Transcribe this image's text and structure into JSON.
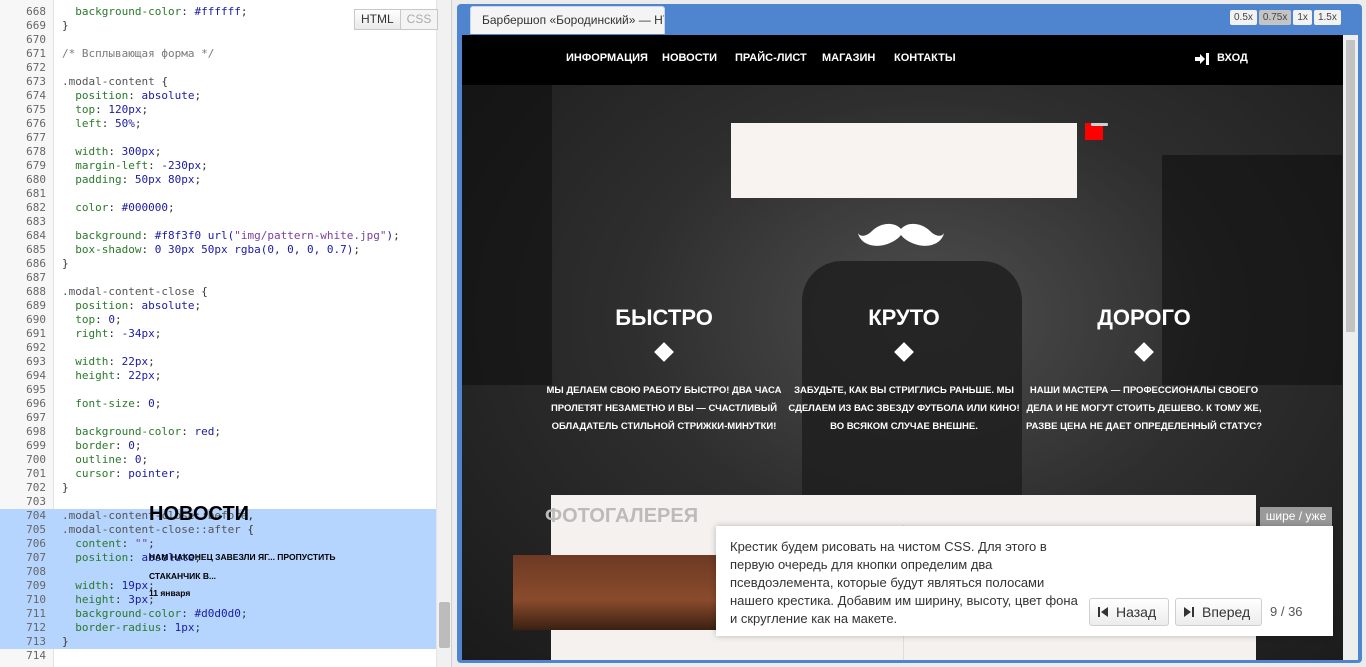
{
  "editor": {
    "tabs": [
      "HTML",
      "CSS"
    ],
    "lines": [
      {
        "n": "668",
        "tokens": [
          [
            "prop",
            "  background-color"
          ],
          [
            "pun",
            ": "
          ],
          [
            "val",
            "#ffffff"
          ],
          [
            "pun",
            ";"
          ]
        ]
      },
      {
        "n": "669",
        "tokens": [
          [
            "pun",
            "}"
          ]
        ]
      },
      {
        "n": "670",
        "tokens": []
      },
      {
        "n": "671",
        "tokens": [
          [
            "com",
            "/* Всплывающая форма */"
          ]
        ]
      },
      {
        "n": "672",
        "tokens": []
      },
      {
        "n": "673",
        "tokens": [
          [
            "sel",
            ".modal-content"
          ],
          [
            "pun",
            " {"
          ]
        ]
      },
      {
        "n": "674",
        "tokens": [
          [
            "prop",
            "  position"
          ],
          [
            "pun",
            ": "
          ],
          [
            "val",
            "absolute"
          ],
          [
            "pun",
            ";"
          ]
        ]
      },
      {
        "n": "675",
        "tokens": [
          [
            "prop",
            "  top"
          ],
          [
            "pun",
            ": "
          ],
          [
            "val",
            "120px"
          ],
          [
            "pun",
            ";"
          ]
        ]
      },
      {
        "n": "676",
        "tokens": [
          [
            "prop",
            "  left"
          ],
          [
            "pun",
            ": "
          ],
          [
            "val",
            "50%"
          ],
          [
            "pun",
            ";"
          ]
        ]
      },
      {
        "n": "677",
        "tokens": []
      },
      {
        "n": "678",
        "tokens": [
          [
            "prop",
            "  width"
          ],
          [
            "pun",
            ": "
          ],
          [
            "val",
            "300px"
          ],
          [
            "pun",
            ";"
          ]
        ]
      },
      {
        "n": "679",
        "tokens": [
          [
            "prop",
            "  margin-left"
          ],
          [
            "pun",
            ": "
          ],
          [
            "val",
            "-230px"
          ],
          [
            "pun",
            ";"
          ]
        ]
      },
      {
        "n": "680",
        "tokens": [
          [
            "prop",
            "  padding"
          ],
          [
            "pun",
            ": "
          ],
          [
            "val",
            "50px 80px"
          ],
          [
            "pun",
            ";"
          ]
        ]
      },
      {
        "n": "681",
        "tokens": []
      },
      {
        "n": "682",
        "tokens": [
          [
            "prop",
            "  color"
          ],
          [
            "pun",
            ": "
          ],
          [
            "val",
            "#000000"
          ],
          [
            "pun",
            ";"
          ]
        ]
      },
      {
        "n": "683",
        "tokens": []
      },
      {
        "n": "684",
        "tokens": [
          [
            "prop",
            "  background"
          ],
          [
            "pun",
            ": "
          ],
          [
            "val",
            "#f8f3f0 url("
          ],
          [
            "str",
            "\"img/pattern-white.jpg\""
          ],
          [
            "val",
            ")"
          ],
          [
            "pun",
            ";"
          ]
        ]
      },
      {
        "n": "685",
        "tokens": [
          [
            "prop",
            "  box-shadow"
          ],
          [
            "pun",
            ": "
          ],
          [
            "val",
            "0 30px 50px rgba(0, 0, 0, 0.7)"
          ],
          [
            "pun",
            ";"
          ]
        ]
      },
      {
        "n": "686",
        "tokens": [
          [
            "pun",
            "}"
          ]
        ]
      },
      {
        "n": "687",
        "tokens": []
      },
      {
        "n": "688",
        "tokens": [
          [
            "sel",
            ".modal-content-close"
          ],
          [
            "pun",
            " {"
          ]
        ]
      },
      {
        "n": "689",
        "tokens": [
          [
            "prop",
            "  position"
          ],
          [
            "pun",
            ": "
          ],
          [
            "val",
            "absolute"
          ],
          [
            "pun",
            ";"
          ]
        ]
      },
      {
        "n": "690",
        "tokens": [
          [
            "prop",
            "  top"
          ],
          [
            "pun",
            ": "
          ],
          [
            "val",
            "0"
          ],
          [
            "pun",
            ";"
          ]
        ]
      },
      {
        "n": "691",
        "tokens": [
          [
            "prop",
            "  right"
          ],
          [
            "pun",
            ": "
          ],
          [
            "val",
            "-34px"
          ],
          [
            "pun",
            ";"
          ]
        ]
      },
      {
        "n": "692",
        "tokens": []
      },
      {
        "n": "693",
        "tokens": [
          [
            "prop",
            "  width"
          ],
          [
            "pun",
            ": "
          ],
          [
            "val",
            "22px"
          ],
          [
            "pun",
            ";"
          ]
        ]
      },
      {
        "n": "694",
        "tokens": [
          [
            "prop",
            "  height"
          ],
          [
            "pun",
            ": "
          ],
          [
            "val",
            "22px"
          ],
          [
            "pun",
            ";"
          ]
        ]
      },
      {
        "n": "695",
        "tokens": []
      },
      {
        "n": "696",
        "tokens": [
          [
            "prop",
            "  font-size"
          ],
          [
            "pun",
            ": "
          ],
          [
            "val",
            "0"
          ],
          [
            "pun",
            ";"
          ]
        ]
      },
      {
        "n": "697",
        "tokens": []
      },
      {
        "n": "698",
        "tokens": [
          [
            "prop",
            "  background-color"
          ],
          [
            "pun",
            ": "
          ],
          [
            "val",
            "red"
          ],
          [
            "pun",
            ";"
          ]
        ]
      },
      {
        "n": "699",
        "tokens": [
          [
            "prop",
            "  border"
          ],
          [
            "pun",
            ": "
          ],
          [
            "val",
            "0"
          ],
          [
            "pun",
            ";"
          ]
        ]
      },
      {
        "n": "700",
        "tokens": [
          [
            "prop",
            "  outline"
          ],
          [
            "pun",
            ": "
          ],
          [
            "val",
            "0"
          ],
          [
            "pun",
            ";"
          ]
        ]
      },
      {
        "n": "701",
        "tokens": [
          [
            "prop",
            "  cursor"
          ],
          [
            "pun",
            ": "
          ],
          [
            "val",
            "pointer"
          ],
          [
            "pun",
            ";"
          ]
        ]
      },
      {
        "n": "702",
        "tokens": [
          [
            "pun",
            "}"
          ]
        ]
      },
      {
        "n": "703",
        "tokens": []
      },
      {
        "n": "704",
        "hl": true,
        "tokens": [
          [
            "sel",
            ".modal-content-close::before"
          ],
          [
            "pun",
            ","
          ]
        ]
      },
      {
        "n": "705",
        "hl": true,
        "tokens": [
          [
            "sel",
            ".modal-content-close::after"
          ],
          [
            "pun",
            " {"
          ]
        ]
      },
      {
        "n": "706",
        "hl": true,
        "tokens": [
          [
            "prop",
            "  content"
          ],
          [
            "pun",
            ": "
          ],
          [
            "str",
            "\"\""
          ],
          [
            "pun",
            ";"
          ]
        ]
      },
      {
        "n": "707",
        "hl": true,
        "tokens": [
          [
            "prop",
            "  position"
          ],
          [
            "pun",
            ": "
          ],
          [
            "val",
            "absolute"
          ],
          [
            "pun",
            ";"
          ]
        ]
      },
      {
        "n": "708",
        "hl": true,
        "tokens": []
      },
      {
        "n": "709",
        "hl": true,
        "tokens": [
          [
            "prop",
            "  width"
          ],
          [
            "pun",
            ": "
          ],
          [
            "val",
            "19px"
          ],
          [
            "pun",
            ";"
          ]
        ]
      },
      {
        "n": "710",
        "hl": true,
        "tokens": [
          [
            "prop",
            "  height"
          ],
          [
            "pun",
            ": "
          ],
          [
            "val",
            "3px"
          ],
          [
            "pun",
            ";"
          ]
        ]
      },
      {
        "n": "711",
        "hl": true,
        "tokens": [
          [
            "prop",
            "  background-color"
          ],
          [
            "pun",
            ": "
          ],
          [
            "val",
            "#d0d0d0"
          ],
          [
            "pun",
            ";"
          ]
        ]
      },
      {
        "n": "712",
        "hl": true,
        "tokens": [
          [
            "prop",
            "  border-radius"
          ],
          [
            "pun",
            ": "
          ],
          [
            "val",
            "1px"
          ],
          [
            "pun",
            ";"
          ]
        ]
      },
      {
        "n": "713",
        "hl": true,
        "tokens": [
          [
            "pun",
            "}"
          ]
        ]
      },
      {
        "n": "714",
        "tokens": []
      }
    ]
  },
  "browser": {
    "tab_title": "Барбершоп «Бородинский» — HTML",
    "zoom_options": [
      "0.5x",
      "0.75x",
      "1x",
      "1.5x"
    ],
    "zoom_active": "0.75x"
  },
  "site": {
    "nav": [
      "ИНФОРМАЦИЯ",
      "НОВОСТИ",
      "ПРАЙС-ЛИСТ",
      "МАГАЗИН",
      "КОНТАКТЫ"
    ],
    "login": "ВХОД",
    "features": [
      {
        "title": "БЫСТРО",
        "text": "МЫ ДЕЛАЕМ СВОЮ РАБОТУ БЫСТРО! ДВА ЧАСА ПРОЛЕТЯТ НЕЗАМЕТНО И ВЫ — СЧАСТЛИВЫЙ ОБЛАДАТЕЛЬ СТИЛЬНОЙ СТРИЖКИ-МИНУТКИ!"
      },
      {
        "title": "КРУТО",
        "text": "ЗАБУДЬТЕ, КАК ВЫ СТРИГЛИСЬ РАНЬШЕ. МЫ СДЕЛАЕМ ИЗ ВАС ЗВЕЗДУ ФУТБОЛА ИЛИ КИНО! ВО ВСЯКОМ СЛУЧАЕ ВНЕШНЕ."
      },
      {
        "title": "ДОРОГО",
        "text": "НАШИ МАСТЕРА — ПРОФЕССИОНАЛЫ СВОЕГО ДЕЛА И НЕ МОГУТ СТОИТЬ ДЕШЕВО. К ТОМУ ЖЕ, РАЗВЕ ЦЕНА НЕ ДАЕТ ОПРЕДЕЛЕННЫЙ СТАТУС?"
      }
    ],
    "news_title": "НОВОСТИ",
    "news_text": "НАМ НАКОНЕЦ ЗАВЕЗЛИ ЯГ... ПРОПУСТИТЬ СТАКАНЧИК В...",
    "news_date": "11 января",
    "gallery_title": "ФОТОГАЛЕРЕЯ"
  },
  "hint": {
    "text": "Крестик будем рисовать на чистом CSS. Для этого в первую очередь для кнопки определим два псевдоэлемента, которые будут являться полосами нашего крестика. Добавим им ширину, высоту, цвет фона и скругление как на макете.",
    "back": "Назад",
    "next": "Вперед",
    "counter": "9 / 36",
    "width_toggle": "шире / уже"
  }
}
